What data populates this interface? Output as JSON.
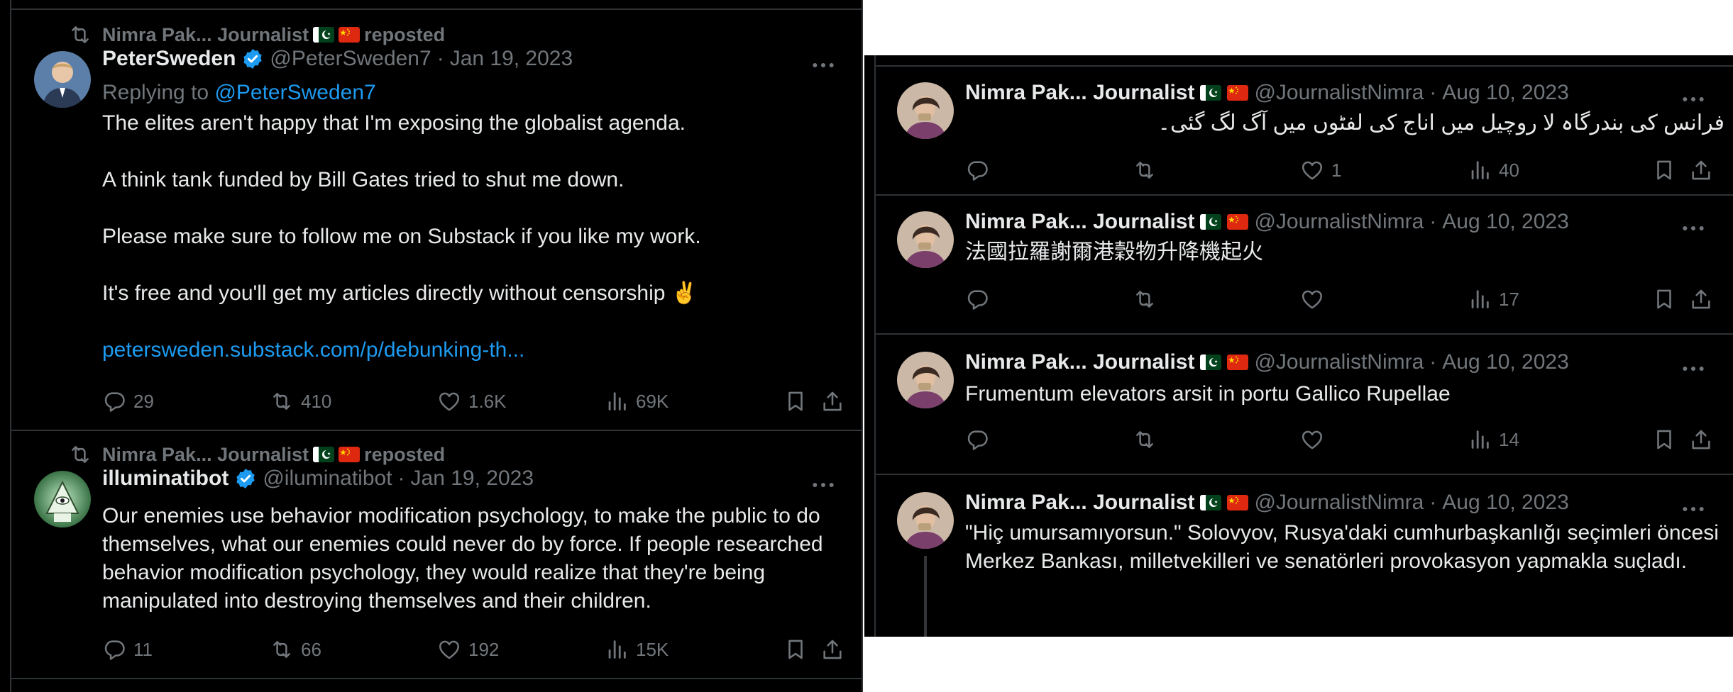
{
  "colors": {
    "background": "#000000",
    "text": "#e7e9ea",
    "muted": "#71767b",
    "link": "#1d9bf0",
    "divider": "#2f3336",
    "verified": "#1d9bf0"
  },
  "left_feed": [
    {
      "reposted_by": "Nimra Pak... Journalist",
      "reposted_label": "reposted",
      "name": "PeterSweden",
      "handle": "@PeterSweden7",
      "date": "Jan 19, 2023",
      "replying_to_label": "Replying to",
      "replying_to_handle": "@PeterSweden7",
      "paragraphs": [
        "The elites aren't happy that I'm exposing the globalist agenda.",
        "A think tank funded by Bill Gates tried to shut me down.",
        "Please make sure to follow me on Substack if you like my work.",
        "It's free and you'll get my articles directly without censorship ✌️"
      ],
      "link": "petersweden.substack.com/p/debunking-th...",
      "replies": "29",
      "reposts": "410",
      "likes": "1.6K",
      "views": "69K"
    },
    {
      "reposted_by": "Nimra Pak... Journalist",
      "reposted_label": "reposted",
      "name": "illuminatibot",
      "handle": "@iluminatibot",
      "date": "Jan 19, 2023",
      "text": "Our enemies use behavior modification psychology, to make the public to do themselves, what our enemies could never do by force. If people researched behavior modification psychology, they would realize that they're being manipulated into destroying themselves and their children.",
      "replies": "11",
      "reposts": "66",
      "likes": "192",
      "views": "15K"
    }
  ],
  "right_feed": [
    {
      "name": "Nimra Pak... Journalist",
      "handle": "@JournalistNimra",
      "date": "Aug 10, 2023",
      "text": "فرانس کی بندرگاہ لا روچیل میں اناج کی لفٹوں میں آگ لگ گئی۔",
      "replies": "",
      "reposts": "",
      "likes": "1",
      "views": "40"
    },
    {
      "name": "Nimra Pak... Journalist",
      "handle": "@JournalistNimra",
      "date": "Aug 10, 2023",
      "text": "法國拉羅謝爾港穀物升降機起火",
      "replies": "",
      "reposts": "",
      "likes": "",
      "views": "17"
    },
    {
      "name": "Nimra Pak... Journalist",
      "handle": "@JournalistNimra",
      "date": "Aug 10, 2023",
      "text": "Frumentum elevators arsit in portu Gallico Rupellae",
      "replies": "",
      "reposts": "",
      "likes": "",
      "views": "14"
    },
    {
      "name": "Nimra Pak... Journalist",
      "handle": "@JournalistNimra",
      "date": "Aug 10, 2023",
      "text": "\"Hiç umursamıyorsun.\" Solovyov, Rusya'daki cumhurbaşkanlığı seçimleri öncesi Merkez Bankası, milletvekilleri ve senatörleri provokasyon yapmakla suçladı."
    }
  ],
  "separator": "·",
  "icons": [
    "repost-icon",
    "verified-badge-icon",
    "pakistan-flag-icon",
    "china-flag-icon",
    "more-icon",
    "reply-icon",
    "like-icon",
    "views-icon",
    "bookmark-icon",
    "share-icon"
  ]
}
